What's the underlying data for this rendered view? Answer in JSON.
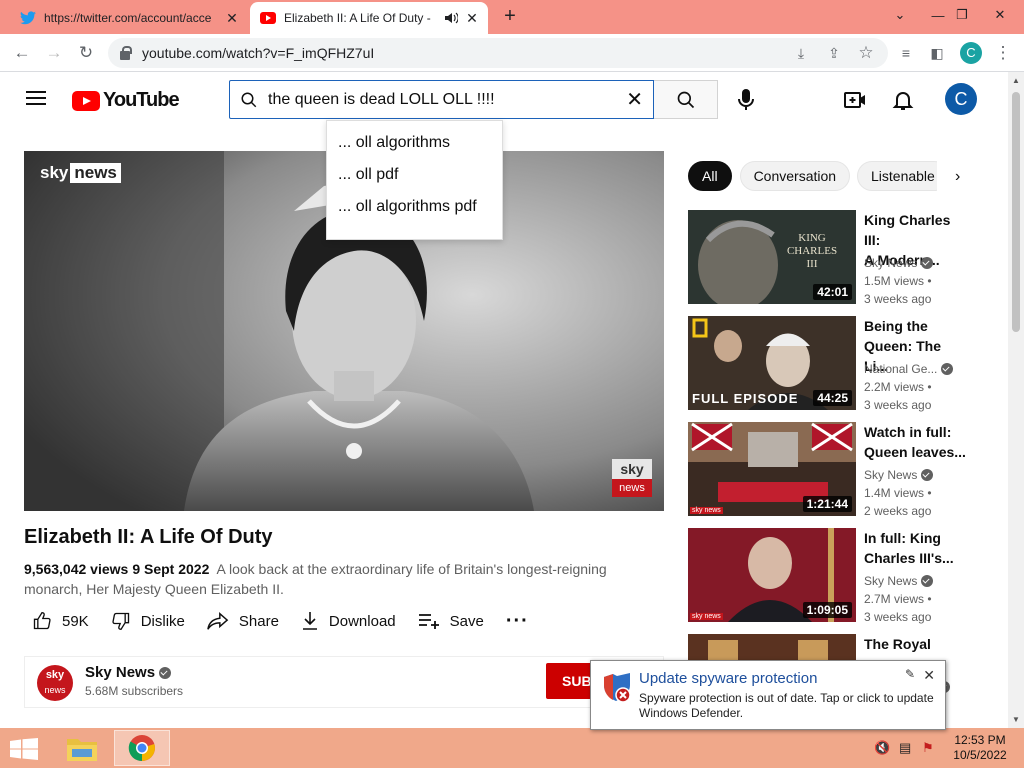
{
  "browser": {
    "tabs": [
      {
        "title": "https://twitter.com/account/acce",
        "icon": "twitter-icon"
      },
      {
        "title": "Elizabeth II: A Life Of Duty - ",
        "icon": "youtube-icon",
        "audio": true
      }
    ],
    "url": "youtube.com/watch?v=F_imQFHZ7uI",
    "profile_initial": "C"
  },
  "youtube": {
    "logo_text": "YouTube",
    "search_query": "the queen is dead LOLL OLL !!!!",
    "suggestions": [
      "... oll algorithms",
      "... oll pdf",
      "... oll algorithms pdf"
    ],
    "avatar_initial": "C"
  },
  "video": {
    "overlay_logo": "sky",
    "overlay_logo_box": "news",
    "bug_top": "sky",
    "bug_bottom": "news",
    "title": "Elizabeth II: A Life Of Duty",
    "views": "9,563,042 views",
    "date": "9 Sept 2022",
    "description": "A look back at the extraordinary life of Britain's longest-reigning monarch, Her Majesty Queen Elizabeth II.",
    "actions": {
      "likes": "59K",
      "dislike": "Dislike",
      "share": "Share",
      "download": "Download",
      "save": "Save"
    },
    "channel": {
      "name": "Sky News",
      "subscribers": "5.68M subscribers",
      "avatar_top": "sky",
      "avatar_bottom": "news",
      "subscribe_label": "SUB"
    }
  },
  "sidebar": {
    "chips": [
      "All",
      "Conversation",
      "Listenable"
    ],
    "recommendations": [
      {
        "title_line1": "King Charles III:",
        "title_line2": "A Modern...",
        "channel": "Sky News",
        "views": "1.5M views •",
        "age": "3 weeks ago",
        "duration": "42:01",
        "thumb_text": "KING CHARLES III"
      },
      {
        "title_line1": "Being the",
        "title_line2": "Queen: The Li...",
        "channel": "National Ge...",
        "views": "2.2M views •",
        "age": "3 weeks ago",
        "duration": "44:25",
        "thumb_text": "FULL EPISODE"
      },
      {
        "title_line1": "Watch in full:",
        "title_line2": "Queen leaves...",
        "channel": "Sky News",
        "views": "1.4M views •",
        "age": "2 weeks ago",
        "duration": "1:21:44",
        "thumb_text": "sky news"
      },
      {
        "title_line1": "In full: King",
        "title_line2": "Charles III's...",
        "channel": "Sky News",
        "views": "2.7M views •",
        "age": "3 weeks ago",
        "duration": "1:09:05",
        "thumb_text": "sky news"
      },
      {
        "title_line1": "The Royal",
        "title_line2": "",
        "channel": "",
        "views": "",
        "age": "",
        "duration": "",
        "thumb_text": ""
      }
    ]
  },
  "notification": {
    "title": "Update spyware protection",
    "body": "Spyware protection is out of date. Tap or click to update Windows Defender."
  },
  "taskbar": {
    "time": "12:53 PM",
    "date": "10/5/2022"
  }
}
